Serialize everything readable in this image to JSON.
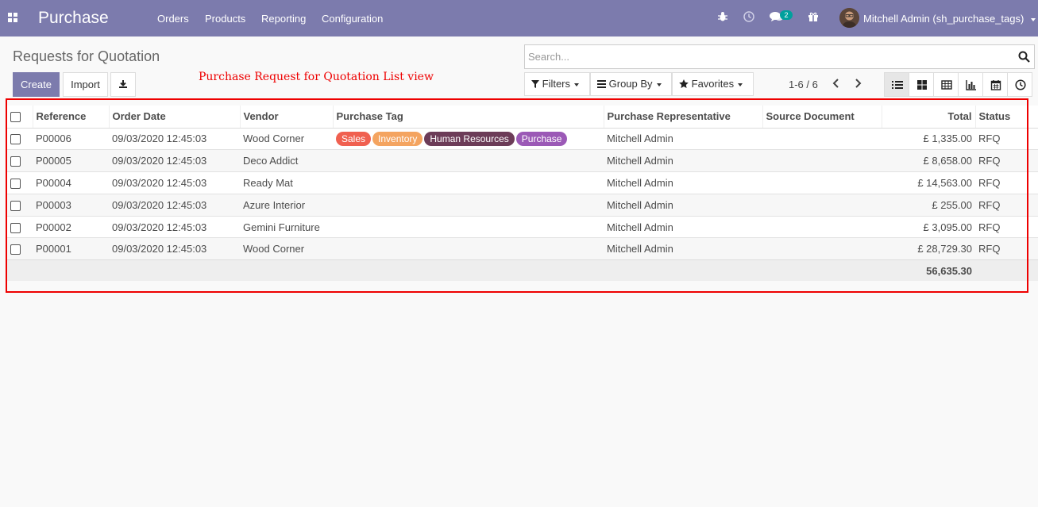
{
  "nav": {
    "brand": "Purchase",
    "menu": [
      "Orders",
      "Products",
      "Reporting",
      "Configuration"
    ],
    "messages_badge": "2",
    "user": "Mitchell Admin (sh_purchase_tags)",
    "color": "#7c7bad"
  },
  "page": {
    "breadcrumb": "Requests for Quotation",
    "annotation": "Purchase Request for Quotation List view"
  },
  "buttons": {
    "create": "Create",
    "import": "Import",
    "download_icon": "download-icon"
  },
  "search": {
    "placeholder": "Search..."
  },
  "filters": {
    "filters": "Filters",
    "group_by": "Group By",
    "favorites": "Favorites"
  },
  "pager": {
    "value": "1-6 / 6"
  },
  "views": [
    "list",
    "kanban",
    "pivot",
    "graph",
    "calendar",
    "activity"
  ],
  "table": {
    "columns": [
      "Reference",
      "Order Date",
      "Vendor",
      "Purchase Tag",
      "Purchase Representative",
      "Source Document",
      "Total",
      "Status"
    ],
    "rows": [
      {
        "reference": "P00006",
        "date": "09/03/2020 12:45:03",
        "vendor": "Wood Corner",
        "tags": [
          "Sales",
          "Inventory",
          "Human Resources",
          "Purchase"
        ],
        "rep": "Mitchell Admin",
        "source": "",
        "total": "£ 1,335.00",
        "status": "RFQ"
      },
      {
        "reference": "P00005",
        "date": "09/03/2020 12:45:03",
        "vendor": "Deco Addict",
        "tags": [],
        "rep": "Mitchell Admin",
        "source": "",
        "total": "£ 8,658.00",
        "status": "RFQ"
      },
      {
        "reference": "P00004",
        "date": "09/03/2020 12:45:03",
        "vendor": "Ready Mat",
        "tags": [],
        "rep": "Mitchell Admin",
        "source": "",
        "total": "£ 14,563.00",
        "status": "RFQ"
      },
      {
        "reference": "P00003",
        "date": "09/03/2020 12:45:03",
        "vendor": "Azure Interior",
        "tags": [],
        "rep": "Mitchell Admin",
        "source": "",
        "total": "£ 255.00",
        "status": "RFQ"
      },
      {
        "reference": "P00002",
        "date": "09/03/2020 12:45:03",
        "vendor": "Gemini Furniture",
        "tags": [],
        "rep": "Mitchell Admin",
        "source": "",
        "total": "£ 3,095.00",
        "status": "RFQ"
      },
      {
        "reference": "P00001",
        "date": "09/03/2020 12:45:03",
        "vendor": "Wood Corner",
        "tags": [],
        "rep": "Mitchell Admin",
        "source": "",
        "total": "£ 28,729.30",
        "status": "RFQ"
      }
    ],
    "footer_total": "56,635.30"
  },
  "tag_colors": {
    "Sales": "#f06050",
    "Inventory": "#f4a460",
    "Human Resources": "#6c3c58",
    "Purchase": "#9b59b6"
  }
}
